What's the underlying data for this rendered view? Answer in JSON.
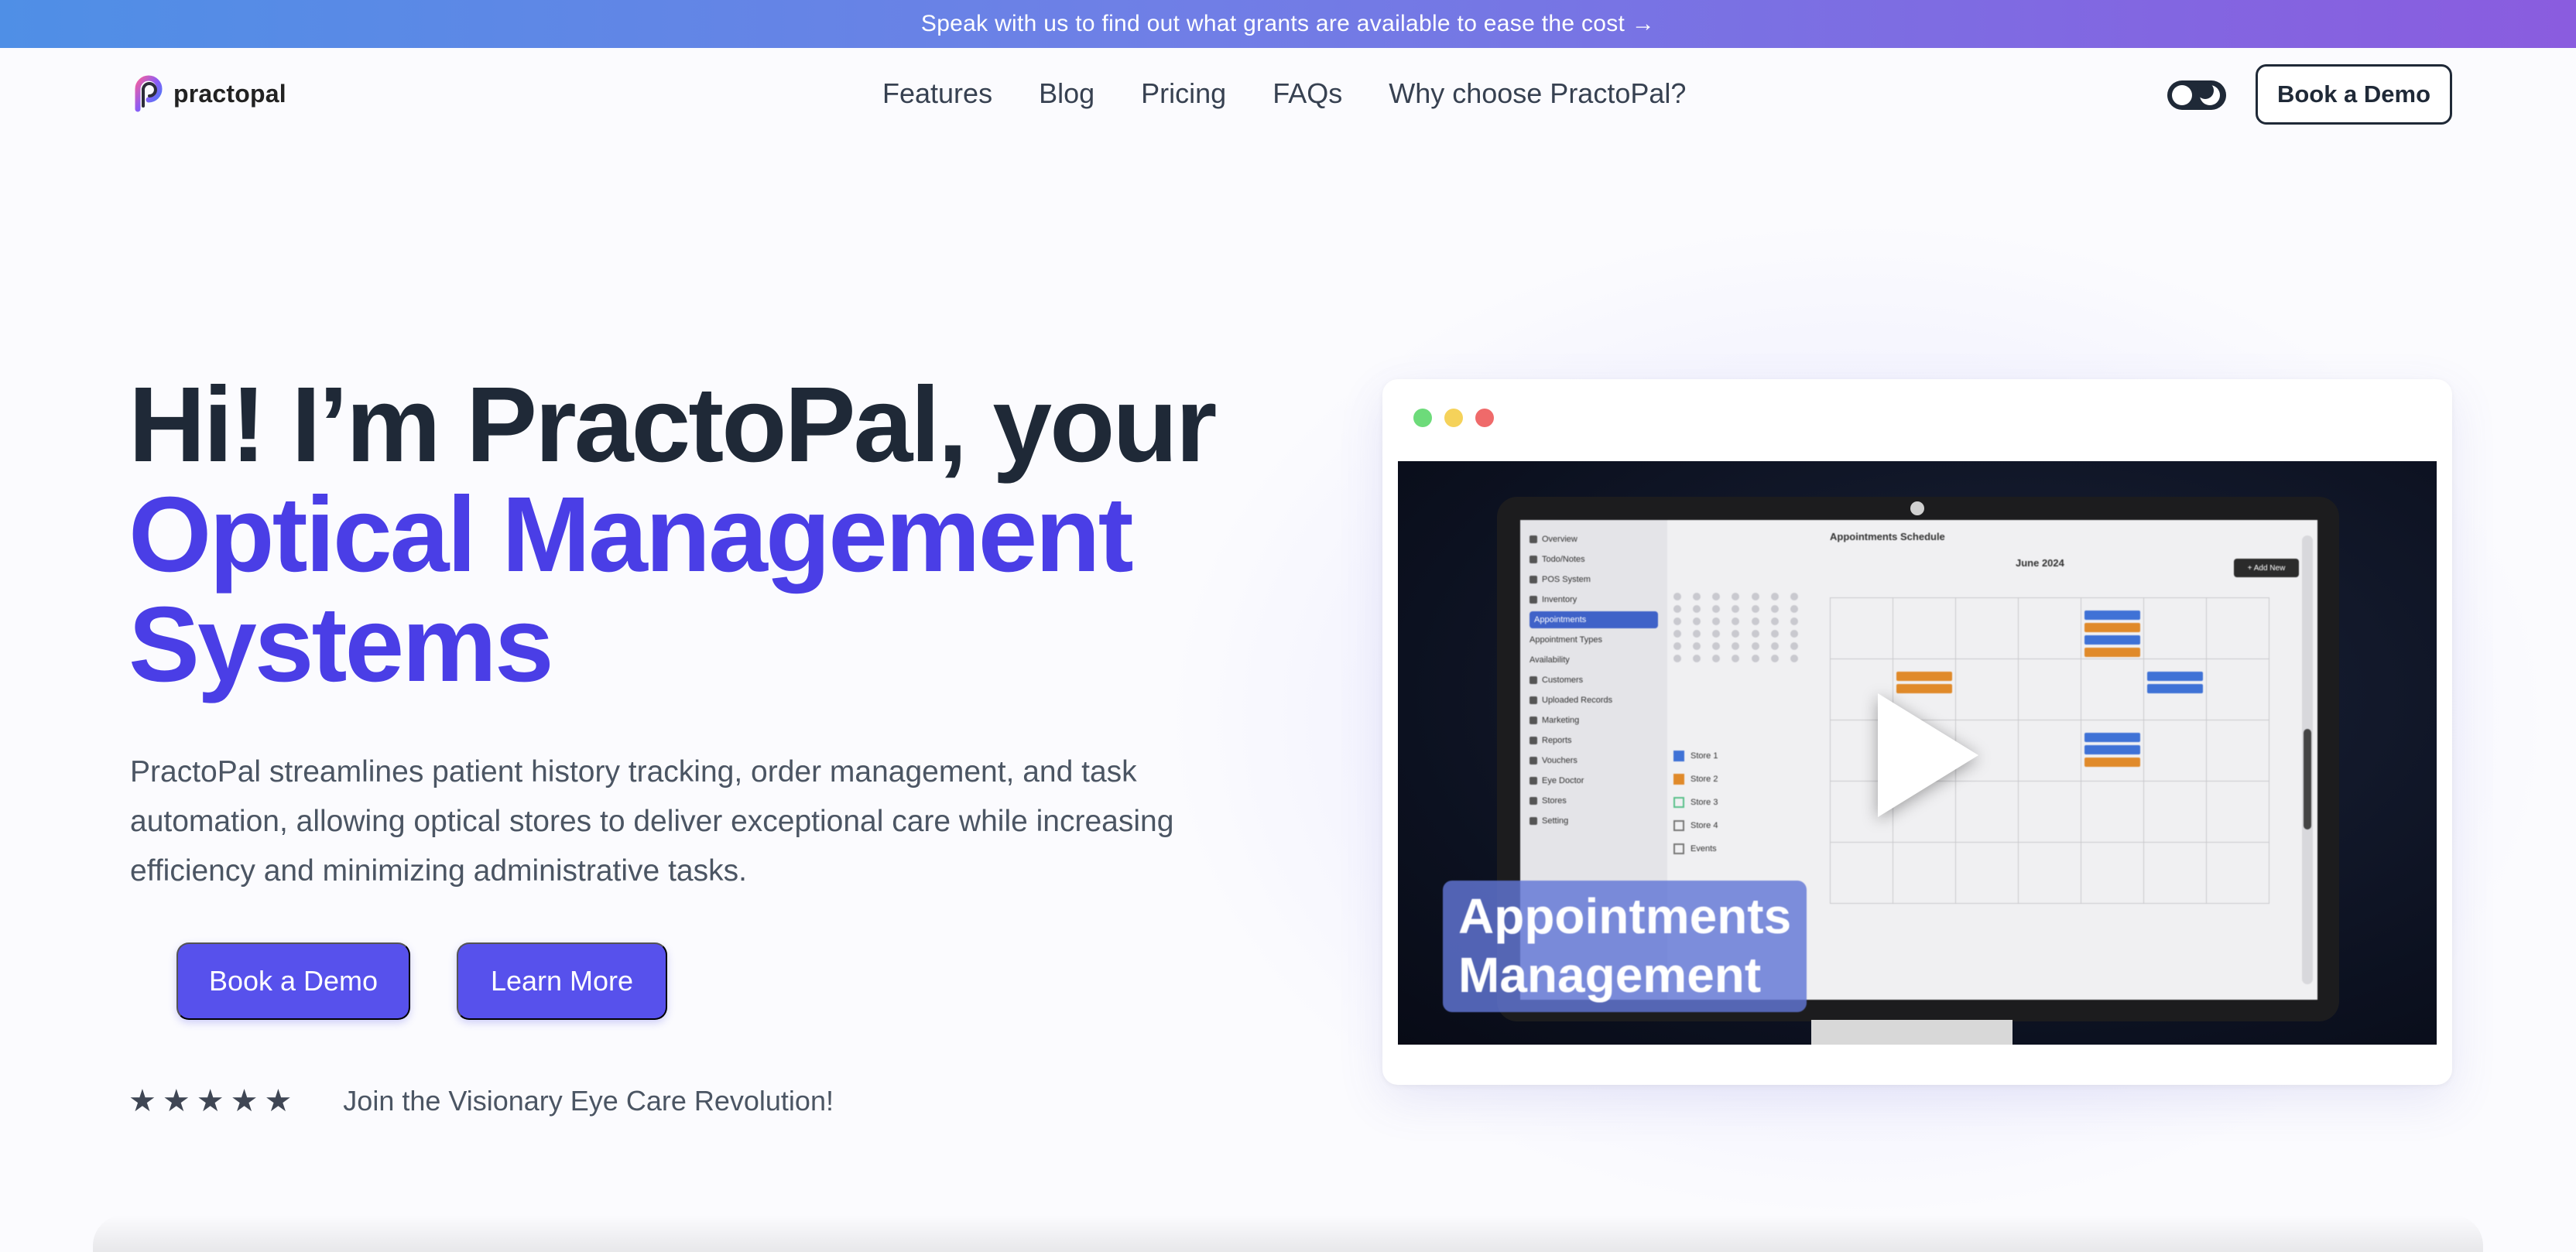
{
  "banner": {
    "text": "Speak with us to find out what grants are available to ease the cost →"
  },
  "nav": {
    "logo_text": "practopal",
    "links": [
      {
        "label": "Features"
      },
      {
        "label": "Blog"
      },
      {
        "label": "Pricing"
      },
      {
        "label": "FAQs"
      },
      {
        "label": "Why choose PractoPal?"
      }
    ],
    "toggle_icon": "theme-toggle-icon",
    "cta_label": "Book a Demo"
  },
  "hero": {
    "title_line1": "Hi! I’m PractoPal, your",
    "title_line2": "Optical Management",
    "title_line3": "Systems",
    "description": "PractoPal streamlines patient history tracking, order management, and task automation, allowing optical stores to deliver exceptional care while increasing efficiency and minimizing administrative tasks.",
    "primary_cta": "Book a Demo",
    "secondary_cta": "Learn More",
    "rating_stars": 5,
    "rating_text": "Join the Visionary Eye Care Revolution!"
  },
  "video": {
    "window_dots": [
      "#6ddb7a",
      "#f5d25a",
      "#ef6a6a"
    ],
    "caption_line1": "Appointments",
    "caption_line2": "Management",
    "play_icon": "play-icon",
    "screen": {
      "title": "Appointments Schedule",
      "month": "June 2024",
      "add_button": "+ Add New",
      "side_items": [
        "Overview",
        "Todo/Notes",
        "POS System",
        "Inventory",
        "Appointments",
        "Appointment Types",
        "Availability",
        "Customers",
        "Uploaded Records",
        "Marketing",
        "Reports",
        "Vouchers",
        "Eye Doctor",
        "Stores",
        "Setting"
      ],
      "calendars": [
        "Store 1",
        "Store 2",
        "Store 3",
        "Store 4",
        "Events"
      ]
    }
  },
  "colors": {
    "accent": "#4a3ee6",
    "button": "#5751ec",
    "dark": "#1f2937"
  }
}
